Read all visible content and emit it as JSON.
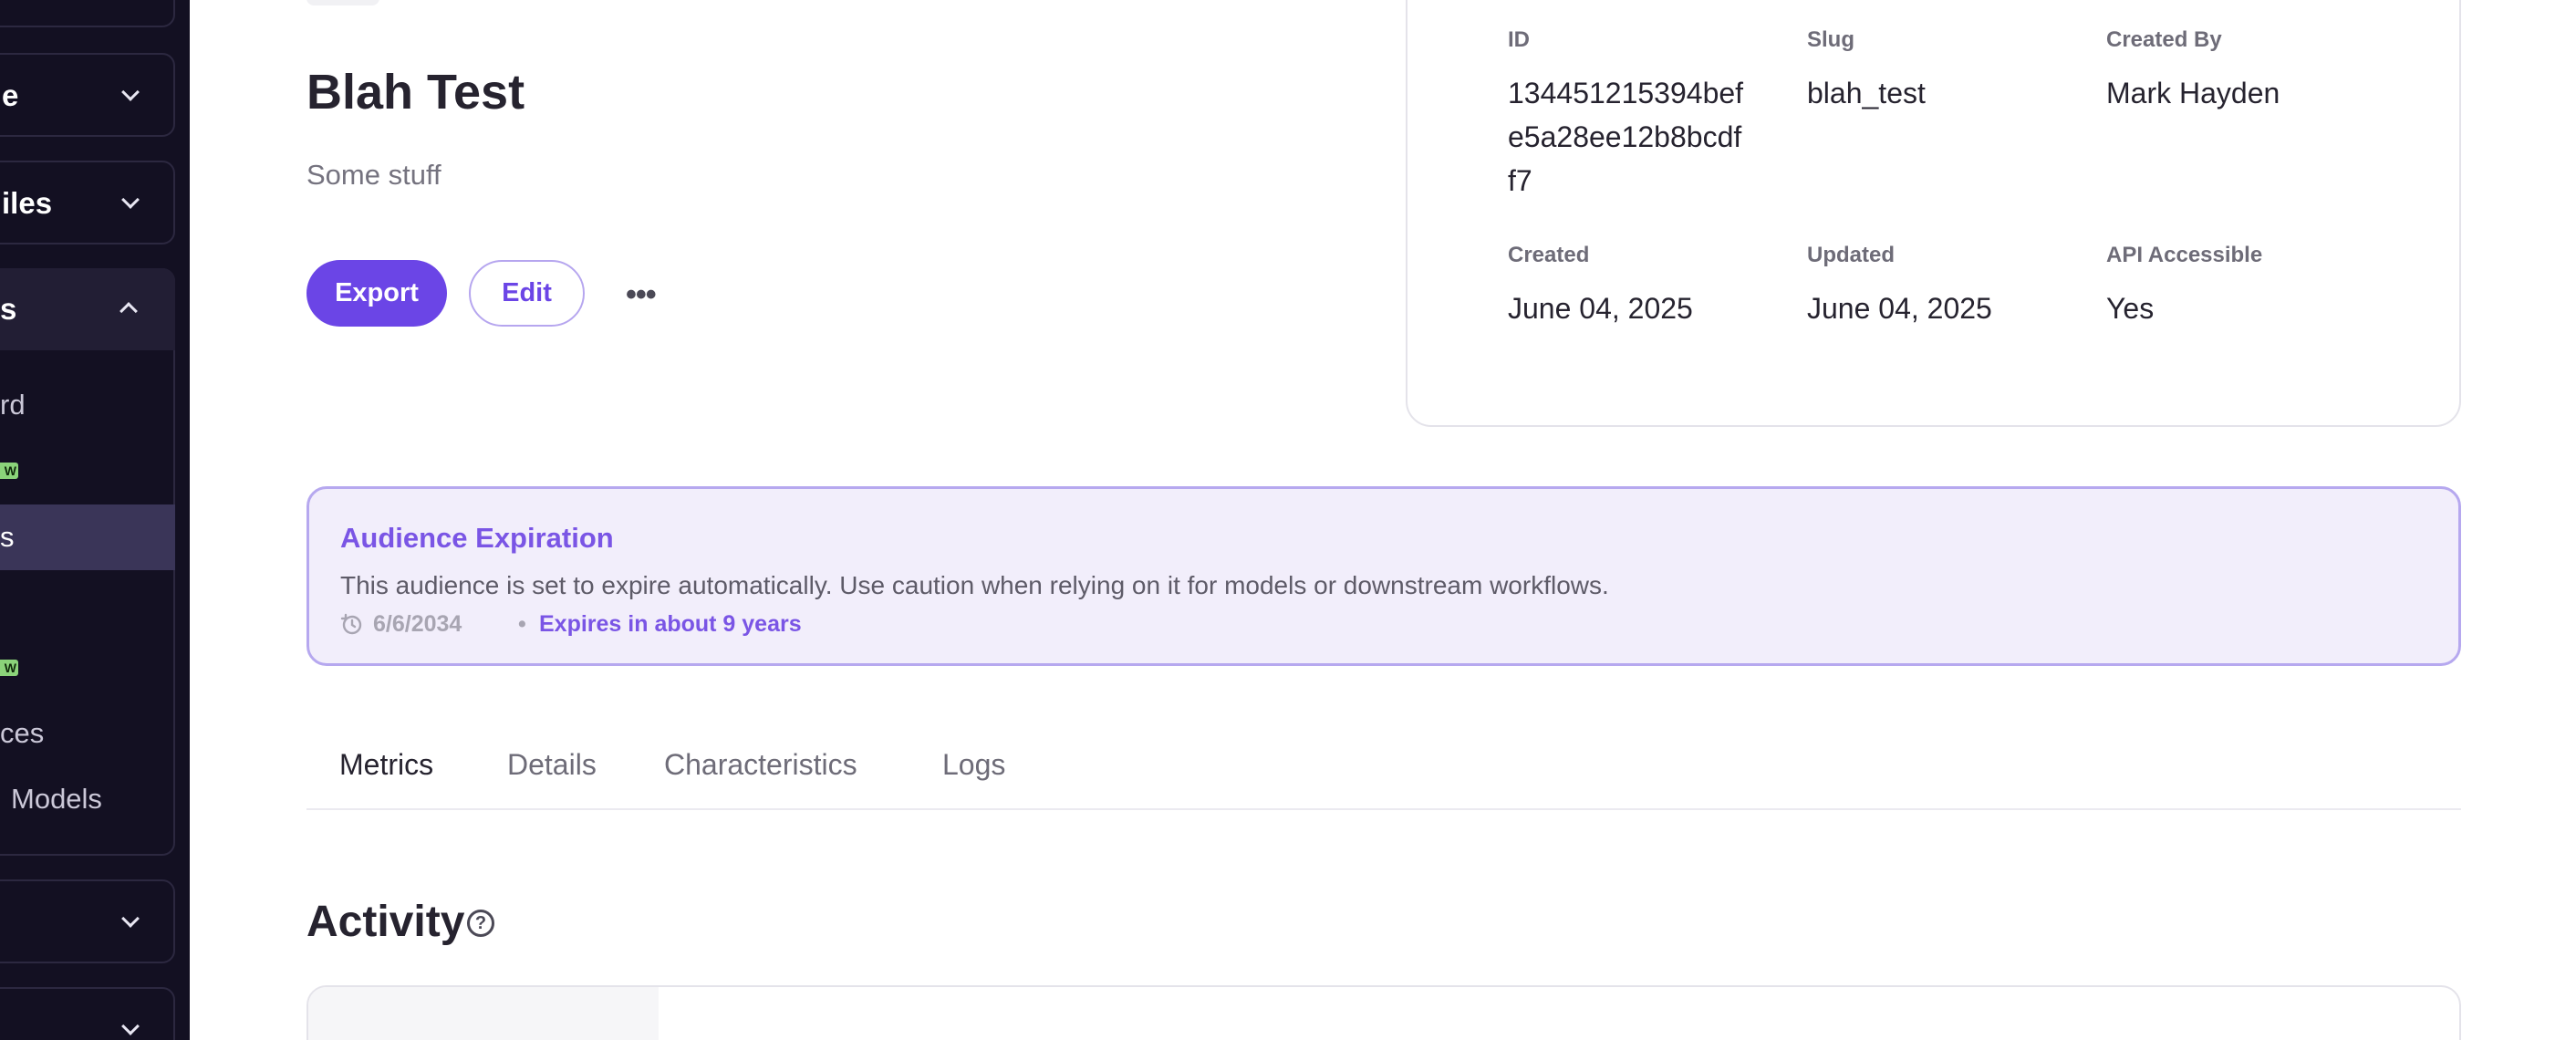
{
  "sidebar": {
    "items": [
      {
        "label": "e",
        "state": "collapsed"
      },
      {
        "label": "iles",
        "state": "collapsed"
      },
      {
        "label": "s",
        "state": "expanded"
      }
    ],
    "sub_items": [
      {
        "label": "rd"
      },
      {
        "label": "s",
        "active": true
      },
      {
        "label": "ces"
      },
      {
        "label": "Models"
      }
    ],
    "new_badge": "W"
  },
  "page": {
    "title": "Blah Test",
    "description": "Some stuff"
  },
  "actions": {
    "export_label": "Export",
    "edit_label": "Edit",
    "more_label": "•••"
  },
  "info": {
    "id_label": "ID",
    "id_value": [
      "134451215394bef",
      "e5a28ee12b8bcdf",
      "f7"
    ],
    "slug_label": "Slug",
    "slug_value": "blah_test",
    "created_by_label": "Created By",
    "created_by_value": "Mark Hayden",
    "created_label": "Created",
    "created_value": "June 04, 2025",
    "updated_label": "Updated",
    "updated_value": "June 04, 2025",
    "api_label": "API Accessible",
    "api_value": "Yes"
  },
  "banner": {
    "title": "Audience Expiration",
    "text": "This audience is set to expire automatically. Use caution when relying on it for models or downstream workflows.",
    "date": "6/6/2034",
    "separator": "•",
    "expires": "Expires in about 9 years"
  },
  "tabs": [
    {
      "label": "Metrics",
      "active": true
    },
    {
      "label": "Details"
    },
    {
      "label": "Characteristics"
    },
    {
      "label": "Logs"
    }
  ],
  "activity": {
    "title": "Activity",
    "help_glyph": "?"
  },
  "colors": {
    "accent": "#6b45e6",
    "sidebar_bg": "#131022",
    "banner_bg": "#f2eefb",
    "new_badge": "#8bd47a"
  }
}
